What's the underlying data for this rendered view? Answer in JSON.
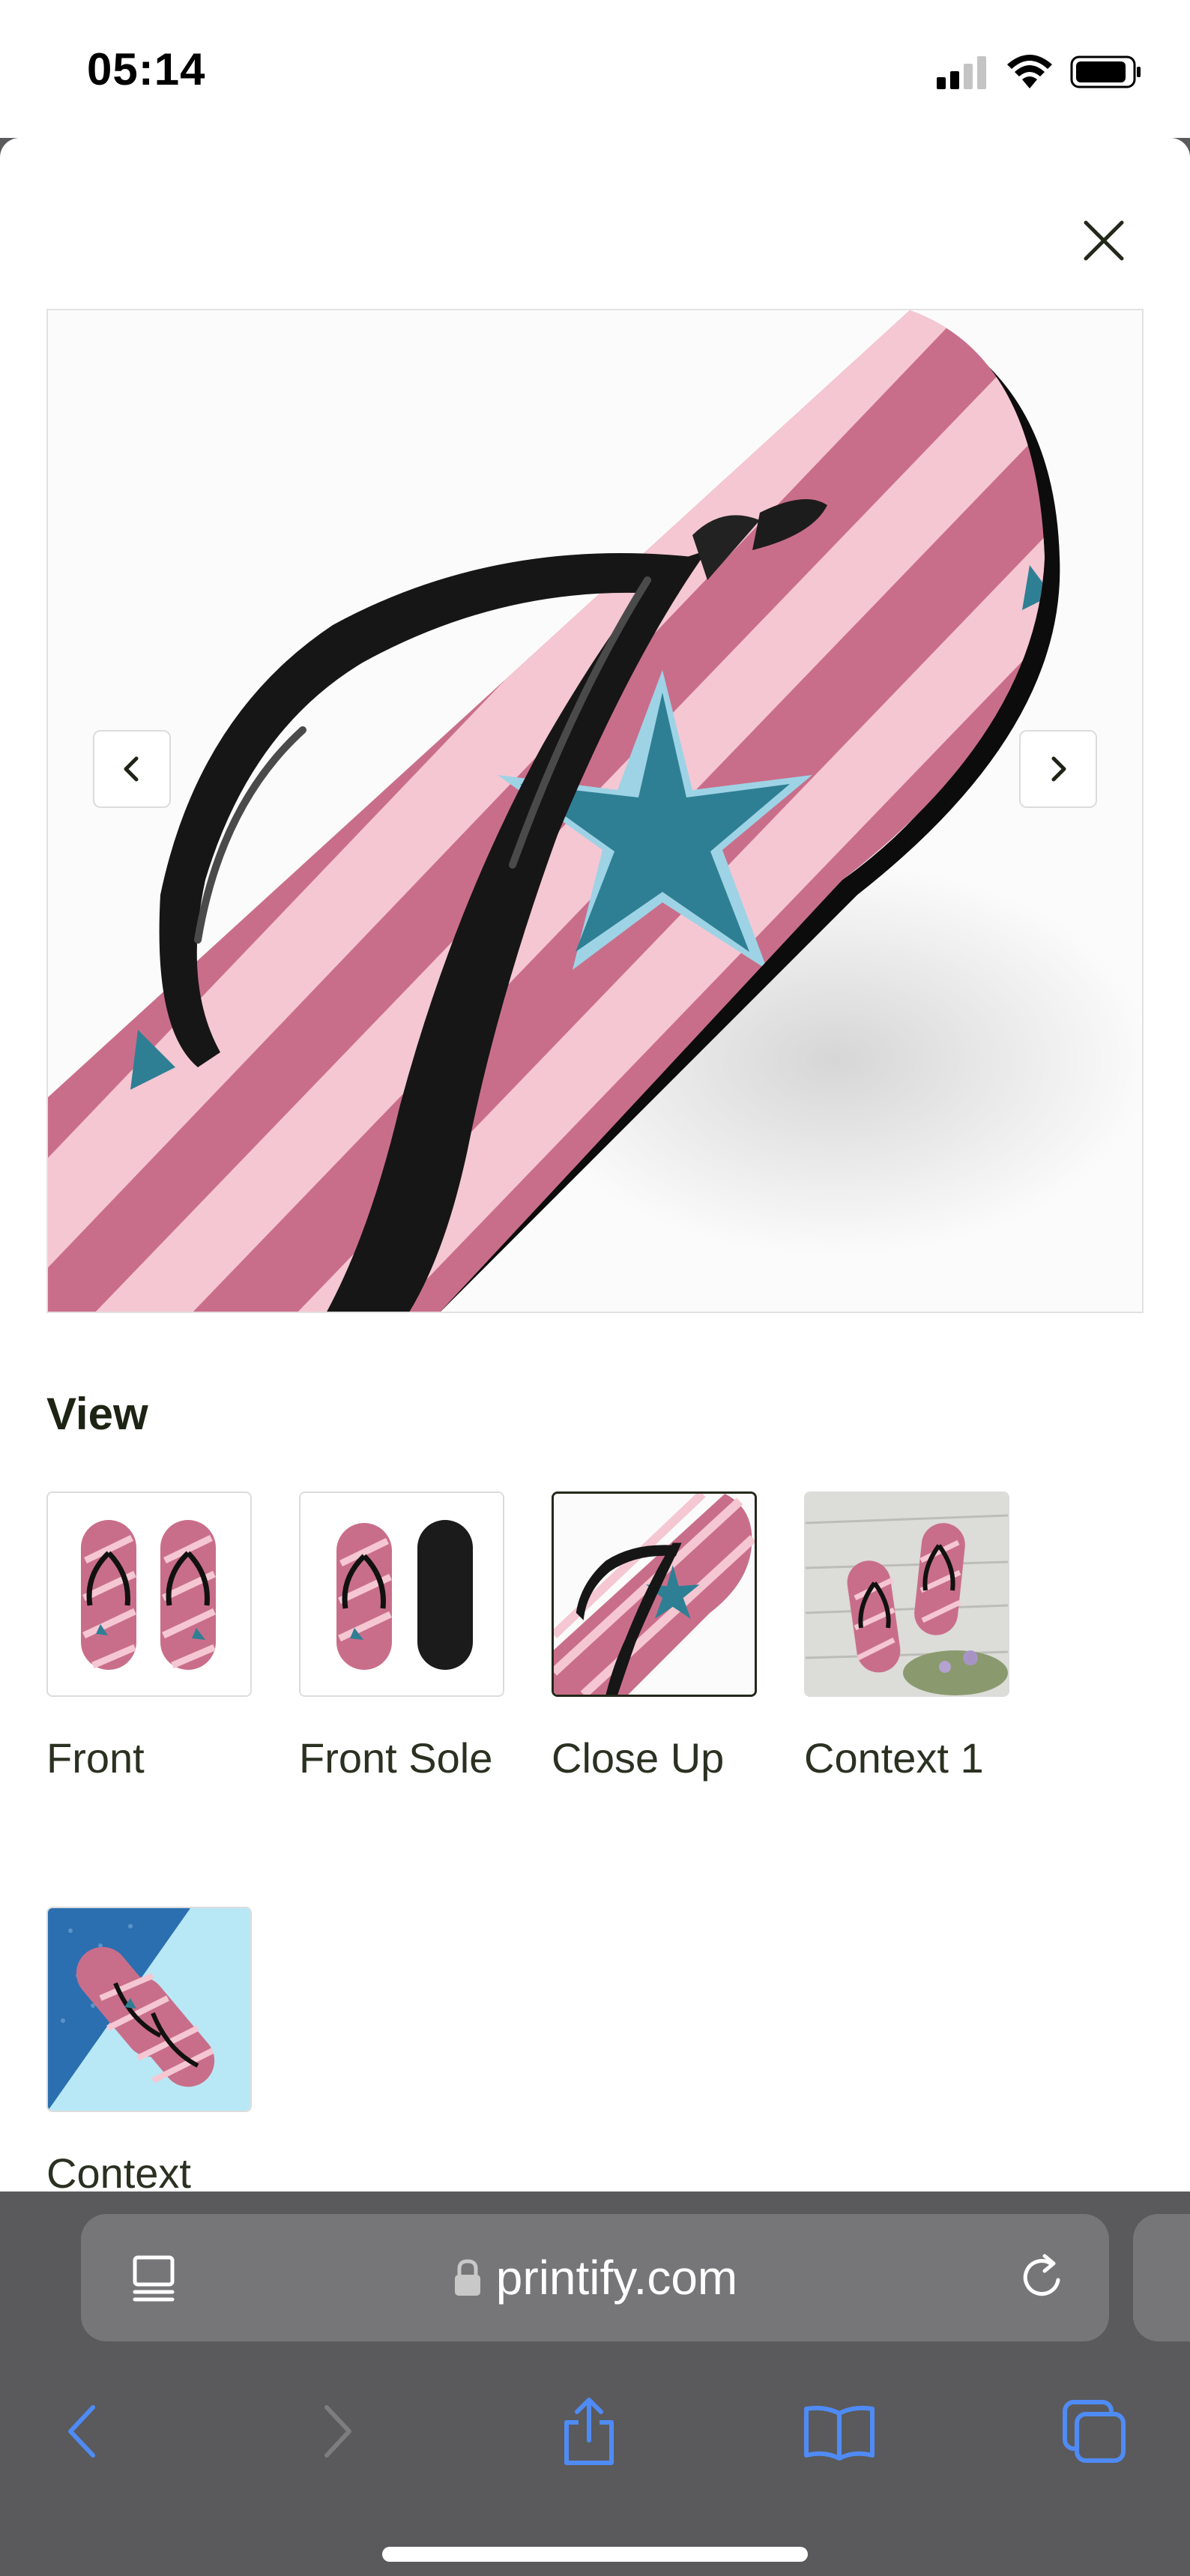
{
  "status_bar": {
    "time": "05:14"
  },
  "sheet": {
    "close_icon": "close-icon",
    "prev_icon": "chevron-left-icon",
    "next_icon": "chevron-right-icon",
    "view_heading": "View",
    "thumbnails": [
      {
        "label": "Front",
        "selected": false
      },
      {
        "label": "Front Sole",
        "selected": false
      },
      {
        "label": "Close Up",
        "selected": true
      },
      {
        "label": "Context 1",
        "selected": false
      },
      {
        "label": "Context",
        "selected": false
      }
    ]
  },
  "browser": {
    "url": "printify.com",
    "reader_icon": "reader-icon",
    "lock_icon": "lock-icon",
    "reload_icon": "reload-icon",
    "toolbar_icons": [
      "back-icon",
      "forward-icon",
      "share-icon",
      "bookmarks-icon",
      "tabs-icon"
    ]
  },
  "colors": {
    "sandal_pink": "#c96e8a",
    "stripe_light": "#f5c7d2",
    "star_teal": "#2f7f94",
    "strap_black": "#161616",
    "browser_blue": "#4f8bf5"
  }
}
